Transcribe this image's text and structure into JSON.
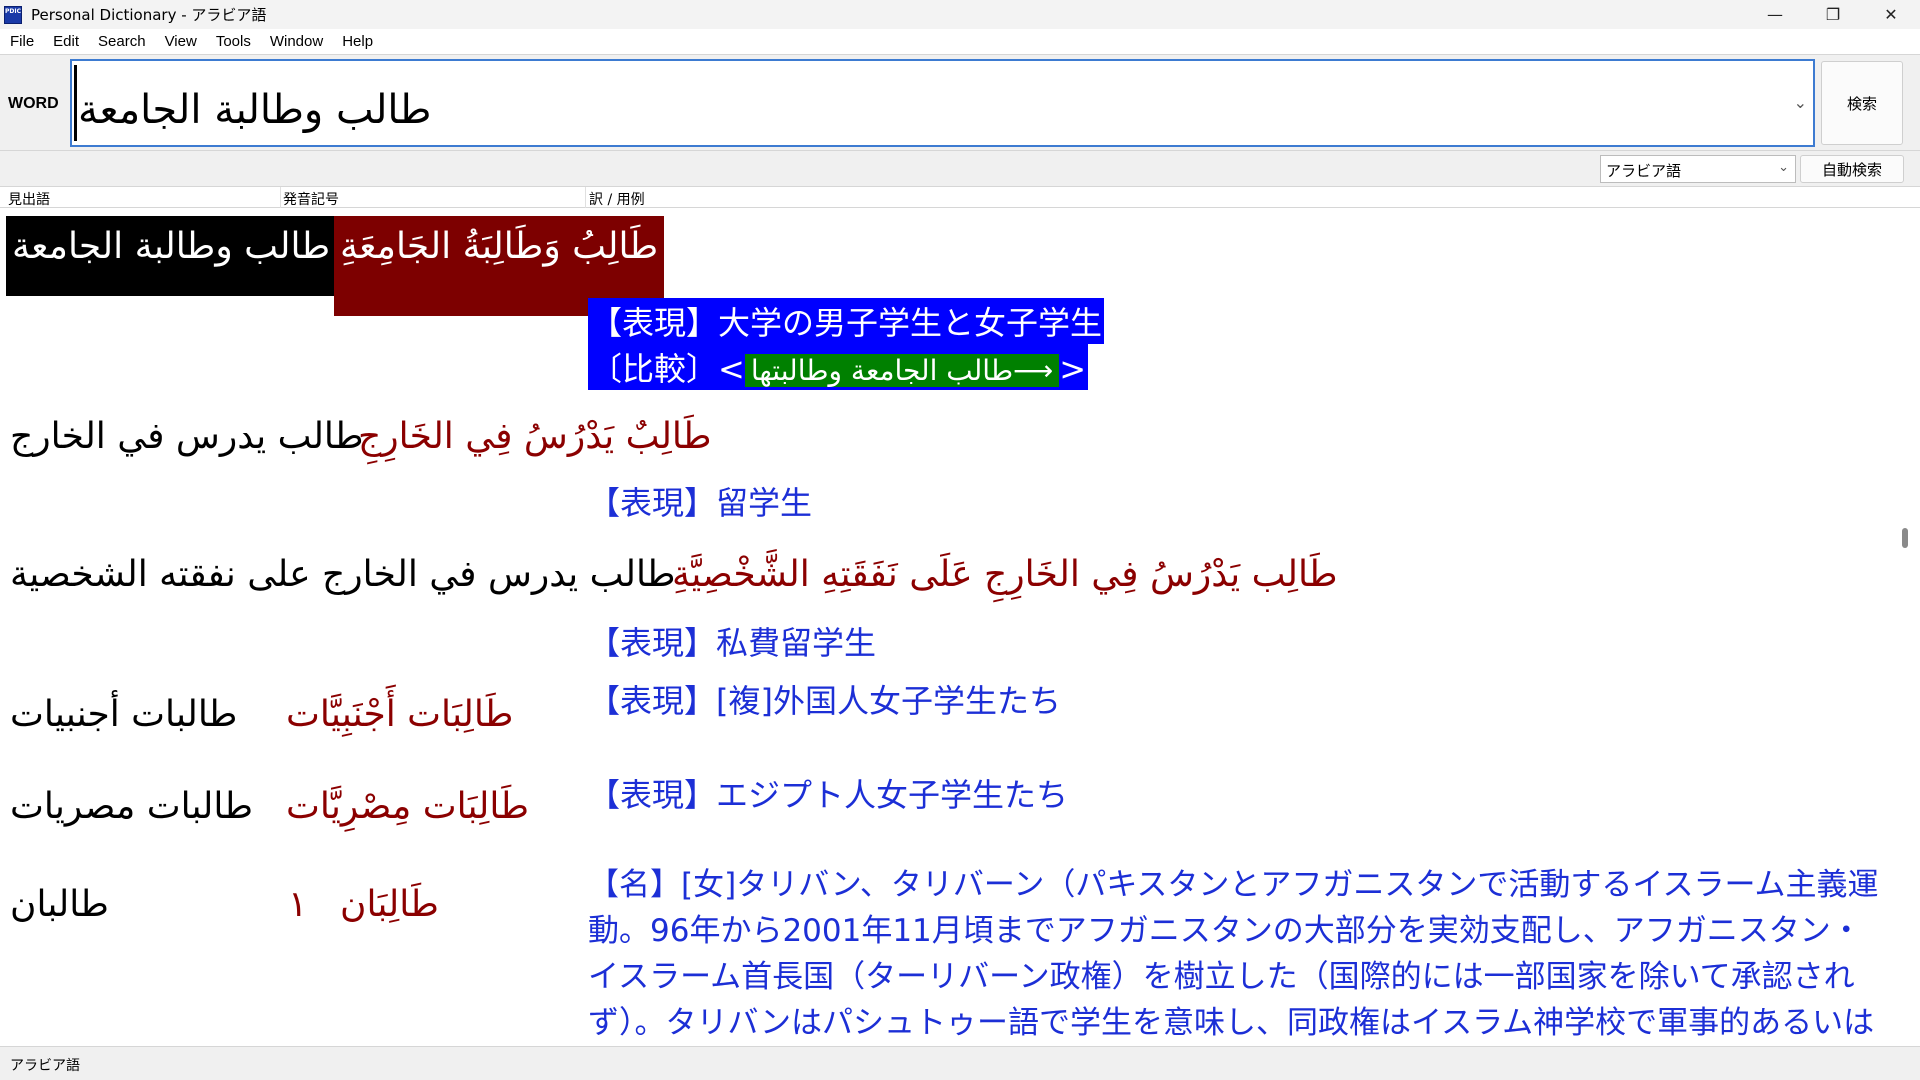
{
  "window": {
    "icon_text": "PDIC",
    "title": "Personal Dictionary - アラビア語",
    "controls": {
      "minimize": "—",
      "maximize": "❐",
      "close": "✕"
    }
  },
  "menu": [
    "File",
    "Edit",
    "Search",
    "View",
    "Tools",
    "Window",
    "Help"
  ],
  "search": {
    "label": "WORD",
    "value": "طالب وطالبة الجامعة",
    "dropdown_arrow": "⌄",
    "button": "検索"
  },
  "options": {
    "language": "アラビア語",
    "language_arrow": "⌄",
    "auto_search": "自動検索"
  },
  "columns": {
    "headword": "見出語",
    "pronunciation": "発音記号",
    "translation": "訳 / 用例"
  },
  "entries": [
    {
      "headword": "طالب وطالبة الجامعة",
      "vocalized": "طَالِبُ وَطَالِبَةُ الجَامِعَةِ",
      "def1": "【表現】大学の男子学生と女子学生",
      "def2_prefix": "〔比較〕<",
      "def2_arrow": "⟶",
      "def2_arabic": "طالب الجامعة وطالبتها",
      "def2_suffix": ">"
    },
    {
      "headword": "طالب يدرس في الخارج",
      "vocalized": "طَالِبٌ يَدْرُسُ فِي الخَارِجِ",
      "def": "【表現】留学生"
    },
    {
      "headword": "طالب يدرس في الخارج على نفقته الشخصية",
      "vocalized": "طَالِب يَدْرُسُ فِي الخَارِجِ عَلَى نَفَقَتِهِ الشَّخْصِيَّةِ",
      "def": "【表現】私費留学生"
    },
    {
      "headword": "طالبات أجنبيات",
      "vocalized": "طَالِبَات أَجْنَبِيَّات",
      "def": "【表現】[複]外国人女子学生たち"
    },
    {
      "headword": "طالبات مصريات",
      "vocalized": "طَالِبَات مِصْرِيَّات",
      "def": "【表現】エジプト人女子学生たち"
    },
    {
      "headword": "طالبان",
      "pron": "١",
      "vocalized": "طَالِبَان",
      "def": "【名】[女]タリバン、タリバーン（パキスタンとアフガニスタンで活動するイスラーム主義運動。96年から2001年11月頃までアフガニスタンの大部分を実効支配し、アフガニスタン・イスラーム首長国（ターリバーン政権）を樹立した（国際的には一部国家を除いて承認されず）。タリバンはパシュトゥー語で学生を意味し、同政権はイスラム神学校で軍事的あるいは神学的に教育"
    }
  ],
  "status": {
    "text": "アラビア語"
  }
}
